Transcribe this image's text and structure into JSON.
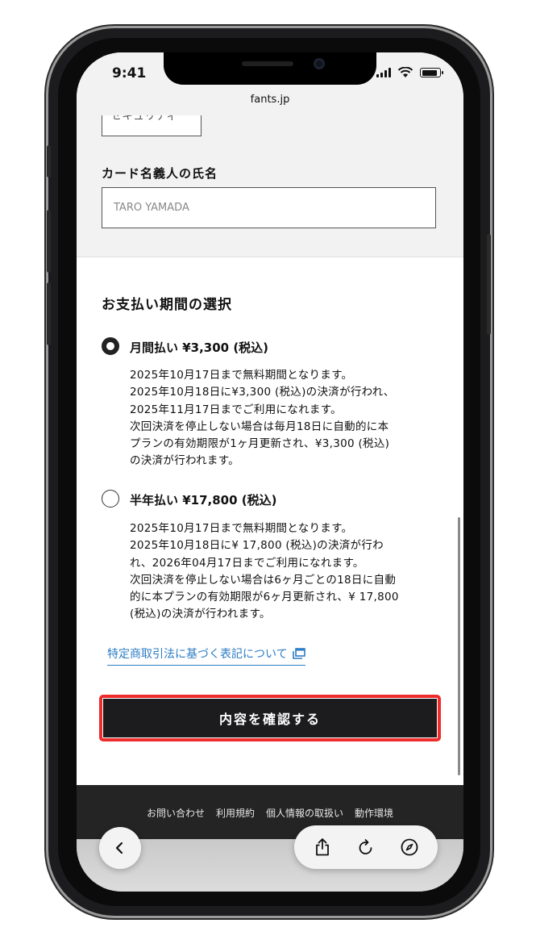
{
  "status_bar": {
    "time": "9:41"
  },
  "browser": {
    "url": "fants.jp"
  },
  "form": {
    "prev_field_value": "セキュリティ",
    "cardholder_label": "カード名義人の氏名",
    "cardholder_placeholder": "TARO YAMADA"
  },
  "payment": {
    "title": "お支払い期間の選択",
    "options": [
      {
        "label": "月間払い ¥3,300 (税込)",
        "selected": true,
        "description_lines": [
          "2025年10月17日まで無料期間となります。",
          "2025年10月18日に¥3,300 (税込)の決済が行われ、",
          "2025年11月17日までご利用になれます。",
          "次回決済を停止しない場合は毎月18日に自動的に本",
          "プランの有効期限が1ヶ月更新され、¥3,300 (税込)",
          "の決済が行われます。"
        ]
      },
      {
        "label": "半年払い ¥17,800 (税込)",
        "selected": false,
        "description_lines": [
          "2025年10月17日まで無料期間となります。",
          "2025年10月18日に¥ 17,800 (税込)の決済が行わ",
          "れ、2026年04月17日までご利用になれます。",
          "次回決済を停止しない場合は6ヶ月ごとの18日に自動",
          "的に本プランの有効期限が6ヶ月更新され、¥ 17,800",
          "(税込)の決済が行われます。"
        ]
      }
    ],
    "legal_link": "特定商取引法に基づく表記について",
    "confirm_button": "内容を確認する"
  },
  "footer": {
    "links": [
      "お問い合わせ",
      "利用規約",
      "個人情報の取扱い",
      "動作環境"
    ]
  },
  "colors": {
    "highlight_border": "#ee2c2c",
    "button_bg": "#1c1c1e",
    "link": "#2d7cc4",
    "footer_bg": "#242424"
  },
  "icons": [
    "back-icon",
    "share-icon",
    "reload-icon",
    "compass-icon",
    "external-link-icon"
  ]
}
